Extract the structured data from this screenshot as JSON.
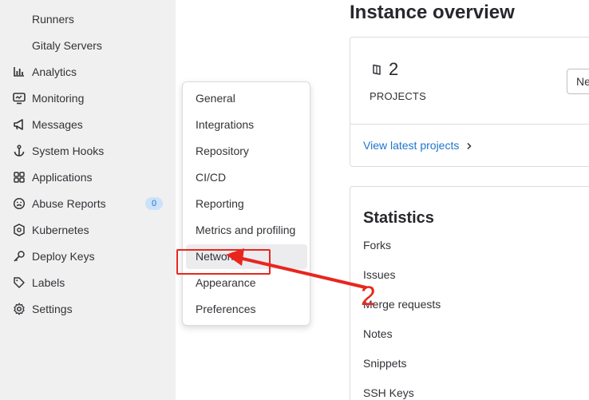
{
  "sidebar": {
    "items": [
      {
        "label": "Runners",
        "icon": "none"
      },
      {
        "label": "Gitaly Servers",
        "icon": "none"
      },
      {
        "label": "Analytics",
        "icon": "chart-icon"
      },
      {
        "label": "Monitoring",
        "icon": "monitor-icon"
      },
      {
        "label": "Messages",
        "icon": "bullhorn-icon"
      },
      {
        "label": "System Hooks",
        "icon": "anchor-icon"
      },
      {
        "label": "Applications",
        "icon": "grid-icon"
      },
      {
        "label": "Abuse Reports",
        "icon": "sad-face-icon",
        "badge": "0"
      },
      {
        "label": "Kubernetes",
        "icon": "kubernetes-icon"
      },
      {
        "label": "Deploy Keys",
        "icon": "key-icon"
      },
      {
        "label": "Labels",
        "icon": "tag-icon"
      },
      {
        "label": "Settings",
        "icon": "gear-icon"
      }
    ]
  },
  "main": {
    "title": "Instance overview",
    "projects": {
      "count": "2",
      "label": "PROJECTS",
      "new_button": "New project",
      "view_link": "View latest projects"
    },
    "statistics": {
      "title": "Statistics",
      "rows": [
        "Forks",
        "Issues",
        "Merge requests",
        "Notes",
        "Snippets",
        "SSH Keys"
      ]
    }
  },
  "settings_menu": {
    "items": [
      "General",
      "Integrations",
      "Repository",
      "CI/CD",
      "Reporting",
      "Metrics and profiling",
      "Network",
      "Appearance",
      "Preferences"
    ],
    "highlighted": "Network"
  },
  "annotation": {
    "number": "2",
    "color": "#e8261e"
  },
  "colors": {
    "sidebar_bg": "#f0f0f0",
    "link": "#1f75cb",
    "badge_bg": "#cbe2f9"
  }
}
